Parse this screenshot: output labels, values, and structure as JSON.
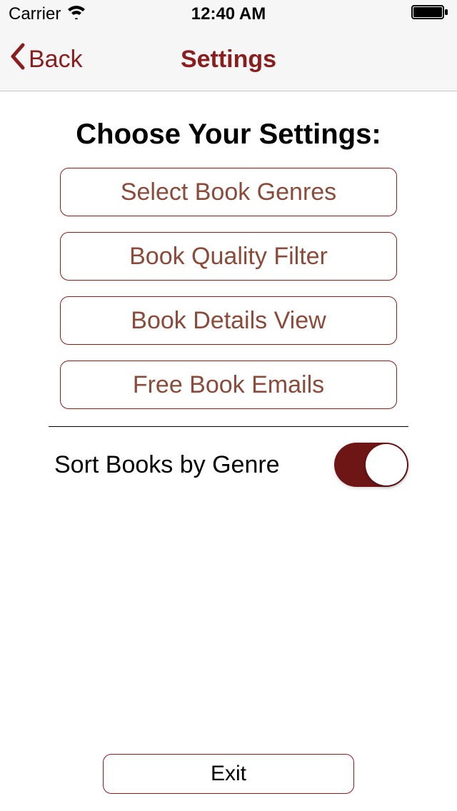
{
  "status_bar": {
    "carrier": "Carrier",
    "time": "12:40 AM"
  },
  "nav": {
    "back_label": "Back",
    "title": "Settings"
  },
  "heading": "Choose Your Settings:",
  "options": {
    "genres": "Select Book Genres",
    "quality": "Book Quality Filter",
    "details": "Book Details View",
    "emails": "Free Book Emails"
  },
  "toggle": {
    "label": "Sort Books by Genre",
    "on": true
  },
  "exit_label": "Exit",
  "colors": {
    "accent": "#8a1d1d"
  }
}
